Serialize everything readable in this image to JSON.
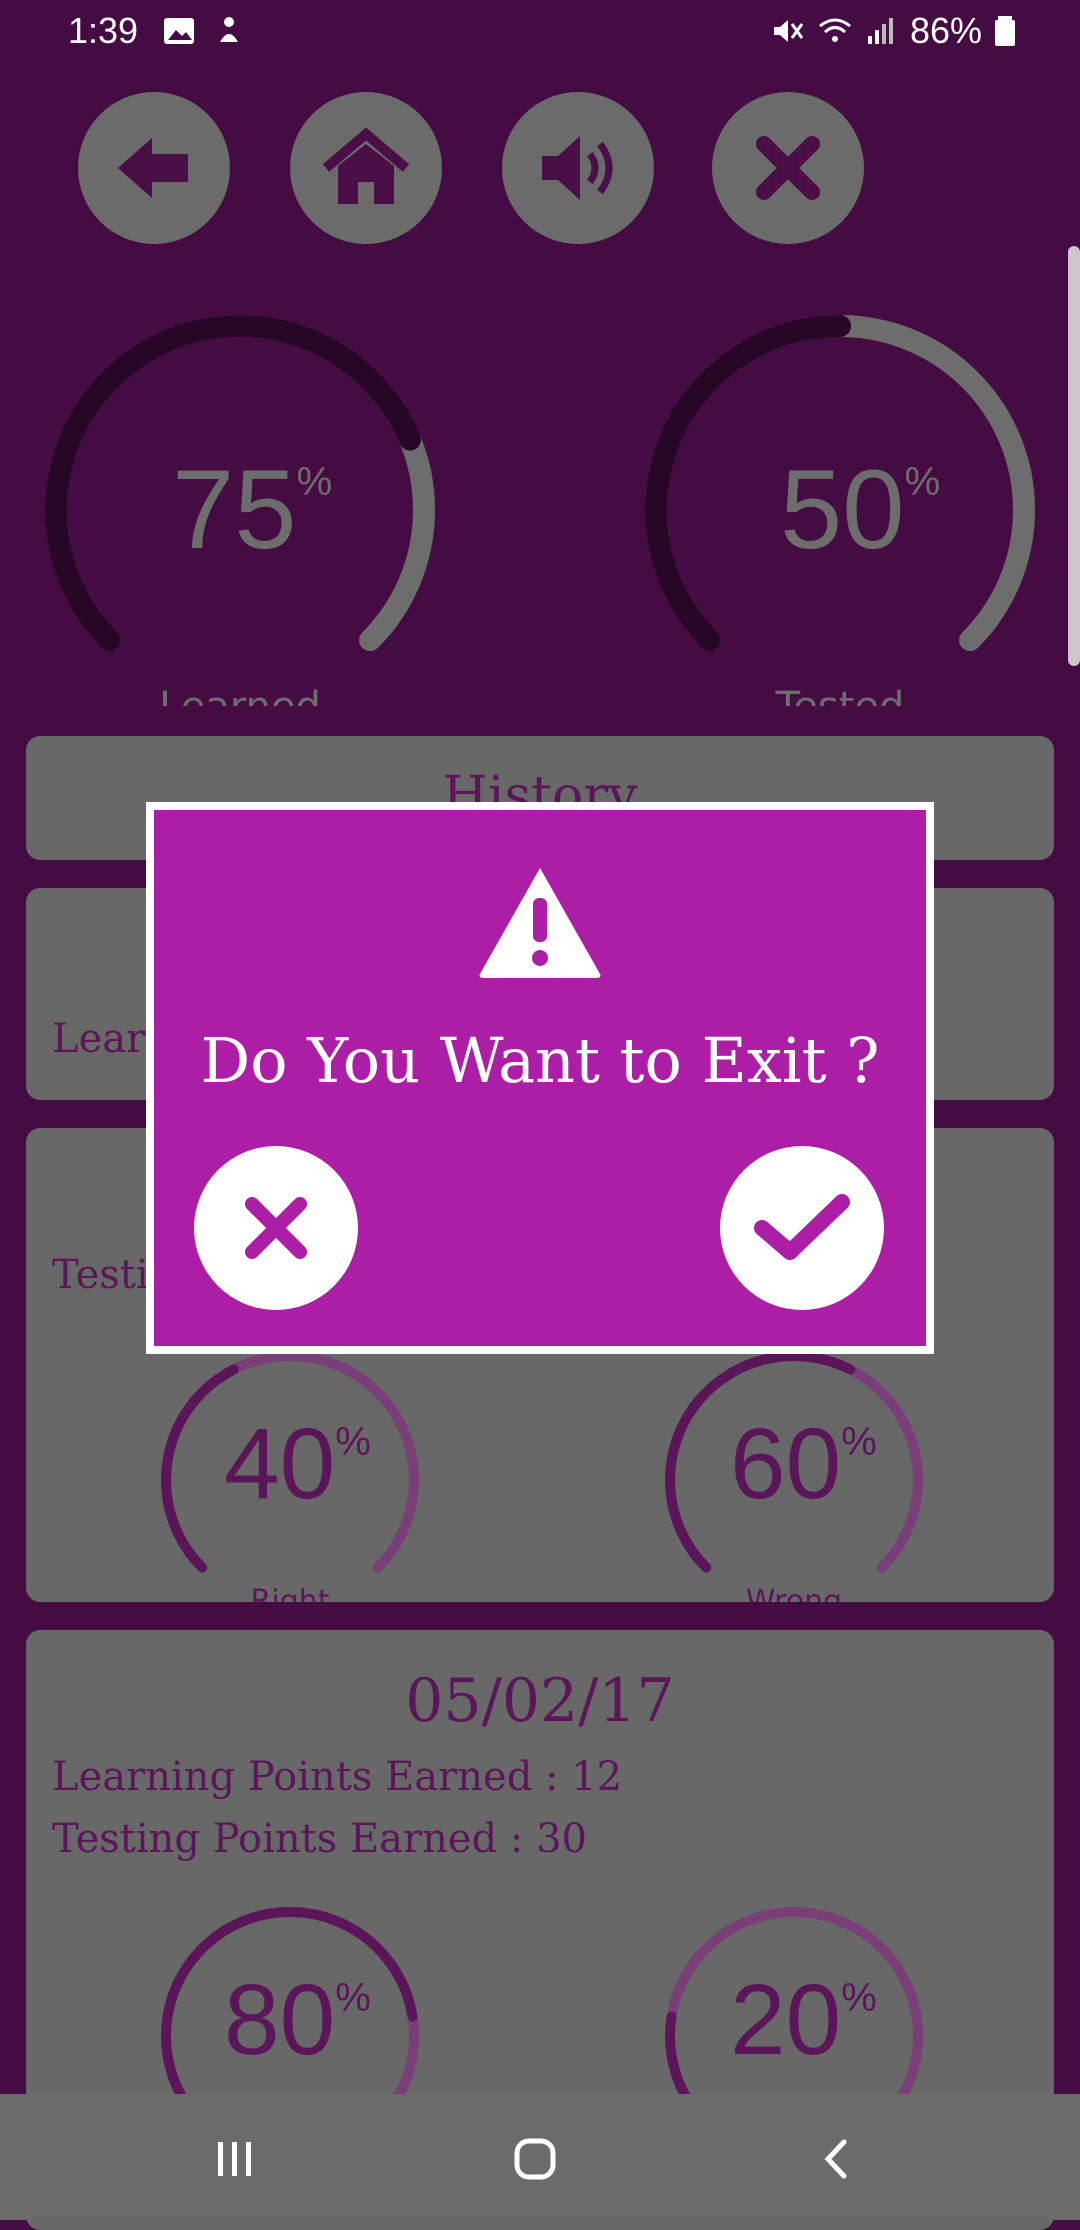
{
  "status": {
    "time": "1:39",
    "battery_text": "86%",
    "icons": [
      "image-icon",
      "notification-icon",
      "mute-icon",
      "wifi-icon",
      "signal-icon",
      "battery-icon"
    ]
  },
  "toolbar": {
    "buttons": [
      "back-icon",
      "home-icon",
      "sound-icon",
      "close-icon"
    ]
  },
  "summary": {
    "learned": {
      "value": "75",
      "unit": "%",
      "label": "Learned",
      "fraction": 0.75
    },
    "tested": {
      "value": "50",
      "unit": "%",
      "label": "Tested",
      "fraction": 0.5
    }
  },
  "history": {
    "title": "History",
    "partial_card_1_label": "Learn",
    "partial_card_2_label": "Testin",
    "row2": {
      "right": {
        "value": "40",
        "unit": "%",
        "label": "Right",
        "fraction": 0.4
      },
      "wrong": {
        "value": "60",
        "unit": "%",
        "label": "Wrong",
        "fraction": 0.6
      }
    },
    "entry": {
      "date": "05/02/17",
      "learning_points": "Learning Points Earned : 12",
      "testing_points": "Testing Points Earned : 30",
      "right": {
        "value": "80",
        "unit": "%",
        "fraction": 0.8
      },
      "wrong": {
        "value": "20",
        "unit": "%",
        "fraction": 0.2
      }
    }
  },
  "dialog": {
    "title": "Do You Want to Exit ?",
    "icon": "warning-icon",
    "cancel_icon": "cancel-icon",
    "confirm_icon": "check-icon"
  },
  "colors": {
    "background": "#450c43",
    "dialog": "#ad1ea6",
    "gray": "#686868",
    "accent_dark": "#5b1559"
  }
}
